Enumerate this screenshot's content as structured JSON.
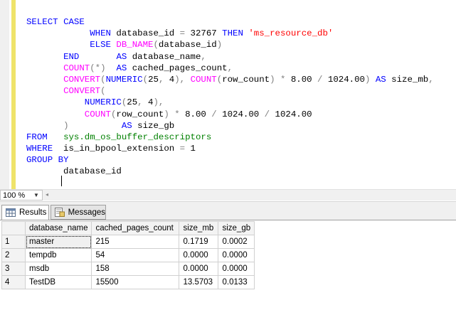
{
  "editor": {
    "lines": [
      [
        {
          "t": "SELECT ",
          "c": "kw"
        },
        {
          "t": "CASE",
          "c": "kw"
        }
      ],
      [
        {
          "t": "            "
        },
        {
          "t": "WHEN",
          "c": "kw"
        },
        {
          "t": " database_id "
        },
        {
          "t": "=",
          "c": "op"
        },
        {
          "t": " 32767 "
        },
        {
          "t": "THEN",
          "c": "kw"
        },
        {
          "t": " "
        },
        {
          "t": "'ms_resource_db'",
          "c": "str"
        }
      ],
      [
        {
          "t": "            "
        },
        {
          "t": "ELSE",
          "c": "kw"
        },
        {
          "t": " "
        },
        {
          "t": "DB_NAME",
          "c": "fn"
        },
        {
          "t": "(",
          "c": "op"
        },
        {
          "t": "database_id"
        },
        {
          "t": ")",
          "c": "op"
        }
      ],
      [
        {
          "t": "       "
        },
        {
          "t": "END",
          "c": "kw"
        },
        {
          "t": "       "
        },
        {
          "t": "AS",
          "c": "kw"
        },
        {
          "t": " database_name"
        },
        {
          "t": ",",
          "c": "op"
        }
      ],
      [
        {
          "t": "       "
        },
        {
          "t": "COUNT",
          "c": "fn"
        },
        {
          "t": "(*)",
          "c": "op"
        },
        {
          "t": "  "
        },
        {
          "t": "AS",
          "c": "kw"
        },
        {
          "t": " cached_pages_count"
        },
        {
          "t": ",",
          "c": "op"
        }
      ],
      [
        {
          "t": "       "
        },
        {
          "t": "CONVERT",
          "c": "fn"
        },
        {
          "t": "(",
          "c": "op"
        },
        {
          "t": "NUMERIC",
          "c": "kw"
        },
        {
          "t": "(",
          "c": "op"
        },
        {
          "t": "25"
        },
        {
          "t": ",",
          "c": "op"
        },
        {
          "t": " 4"
        },
        {
          "t": "),",
          "c": "op"
        },
        {
          "t": " "
        },
        {
          "t": "COUNT",
          "c": "fn"
        },
        {
          "t": "(",
          "c": "op"
        },
        {
          "t": "row_count"
        },
        {
          "t": ")",
          "c": "op"
        },
        {
          "t": " "
        },
        {
          "t": "*",
          "c": "op"
        },
        {
          "t": " 8.00 "
        },
        {
          "t": "/",
          "c": "op"
        },
        {
          "t": " 1024.00"
        },
        {
          "t": ")",
          "c": "op"
        },
        {
          "t": " "
        },
        {
          "t": "AS",
          "c": "kw"
        },
        {
          "t": " size_mb"
        },
        {
          "t": ",",
          "c": "op"
        }
      ],
      [
        {
          "t": "       "
        },
        {
          "t": "CONVERT",
          "c": "fn"
        },
        {
          "t": "(",
          "c": "op"
        }
      ],
      [
        {
          "t": "           "
        },
        {
          "t": "NUMERIC",
          "c": "kw"
        },
        {
          "t": "(",
          "c": "op"
        },
        {
          "t": "25"
        },
        {
          "t": ",",
          "c": "op"
        },
        {
          "t": " 4"
        },
        {
          "t": "),",
          "c": "op"
        }
      ],
      [
        {
          "t": "           "
        },
        {
          "t": "COUNT",
          "c": "fn"
        },
        {
          "t": "(",
          "c": "op"
        },
        {
          "t": "row_count"
        },
        {
          "t": ")",
          "c": "op"
        },
        {
          "t": " "
        },
        {
          "t": "*",
          "c": "op"
        },
        {
          "t": " 8.00 "
        },
        {
          "t": "/",
          "c": "op"
        },
        {
          "t": " 1024.00 "
        },
        {
          "t": "/",
          "c": "op"
        },
        {
          "t": " 1024.00"
        }
      ],
      [
        {
          "t": "       "
        },
        {
          "t": ")",
          "c": "op"
        },
        {
          "t": "          "
        },
        {
          "t": "AS",
          "c": "kw"
        },
        {
          "t": " size_gb"
        }
      ],
      [
        {
          "t": "FROM",
          "c": "kw"
        },
        {
          "t": "   "
        },
        {
          "t": "sys.dm_os_buffer_descriptors",
          "c": "sys"
        }
      ],
      [
        {
          "t": "WHERE",
          "c": "kw"
        },
        {
          "t": "  is_in_bpool_extension "
        },
        {
          "t": "=",
          "c": "op"
        },
        {
          "t": " 1"
        }
      ],
      [
        {
          "t": "GROUP",
          "c": "kw"
        },
        {
          "t": " "
        },
        {
          "t": "BY",
          "c": "kw"
        }
      ],
      [
        {
          "t": "       database_id"
        }
      ]
    ]
  },
  "zoom": {
    "value": "100 %"
  },
  "tabs": [
    {
      "label": "Results",
      "icon": "grid-icon"
    },
    {
      "label": "Messages",
      "icon": "messages-icon"
    }
  ],
  "grid": {
    "columns": [
      "database_name",
      "cached_pages_count",
      "size_mb",
      "size_gb"
    ],
    "rows": [
      {
        "num": "1",
        "cells": [
          "master",
          "215",
          "0.1719",
          "0.0002"
        ]
      },
      {
        "num": "2",
        "cells": [
          "tempdb",
          "54",
          "0.0000",
          "0.0000"
        ]
      },
      {
        "num": "3",
        "cells": [
          "msdb",
          "158",
          "0.0000",
          "0.0000"
        ]
      },
      {
        "num": "4",
        "cells": [
          "TestDB",
          "15500",
          "13.5703",
          "0.0133"
        ]
      }
    ]
  }
}
